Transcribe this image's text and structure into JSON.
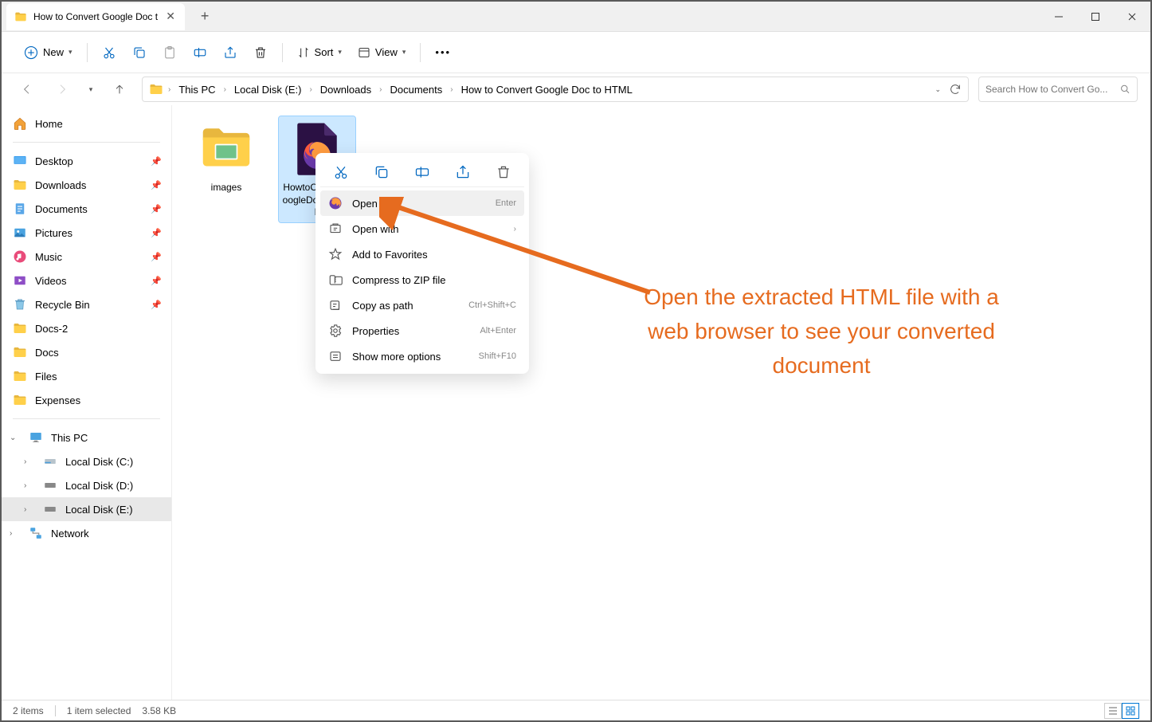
{
  "tab": {
    "title": "How to Convert Google Doc t"
  },
  "toolbar": {
    "new": "New",
    "sort": "Sort",
    "view": "View"
  },
  "breadcrumb": {
    "items": [
      "This PC",
      "Local Disk (E:)",
      "Downloads",
      "Documents",
      "How to Convert Google Doc to HTML"
    ]
  },
  "search": {
    "placeholder": "Search How to Convert Go..."
  },
  "sidebar": {
    "home": "Home",
    "quick": [
      {
        "label": "Desktop",
        "icon": "desktop"
      },
      {
        "label": "Downloads",
        "icon": "folder"
      },
      {
        "label": "Documents",
        "icon": "document"
      },
      {
        "label": "Pictures",
        "icon": "pictures"
      },
      {
        "label": "Music",
        "icon": "music"
      },
      {
        "label": "Videos",
        "icon": "videos"
      },
      {
        "label": "Recycle Bin",
        "icon": "recycle"
      },
      {
        "label": "Docs-2",
        "icon": "folder"
      },
      {
        "label": "Docs",
        "icon": "folder"
      },
      {
        "label": "Files",
        "icon": "folder"
      },
      {
        "label": "Expenses",
        "icon": "folder"
      }
    ],
    "thispc": "This PC",
    "drives": [
      "Local Disk (C:)",
      "Local Disk (D:)",
      "Local Disk (E:)"
    ],
    "network": "Network"
  },
  "files": {
    "folder": {
      "name": "images"
    },
    "html": {
      "name": "HowtoConvertGoogleDoctoHTML"
    }
  },
  "context": {
    "open": "Open",
    "open_shortcut": "Enter",
    "openwith": "Open with",
    "fav": "Add to Favorites",
    "zip": "Compress to ZIP file",
    "copypath": "Copy as path",
    "copypath_shortcut": "Ctrl+Shift+C",
    "props": "Properties",
    "props_shortcut": "Alt+Enter",
    "more": "Show more options",
    "more_shortcut": "Shift+F10"
  },
  "status": {
    "count": "2 items",
    "selected": "1 item selected",
    "size": "3.58 KB"
  },
  "annotation": {
    "text": "Open the extracted HTML file with a web browser to see your converted document"
  }
}
